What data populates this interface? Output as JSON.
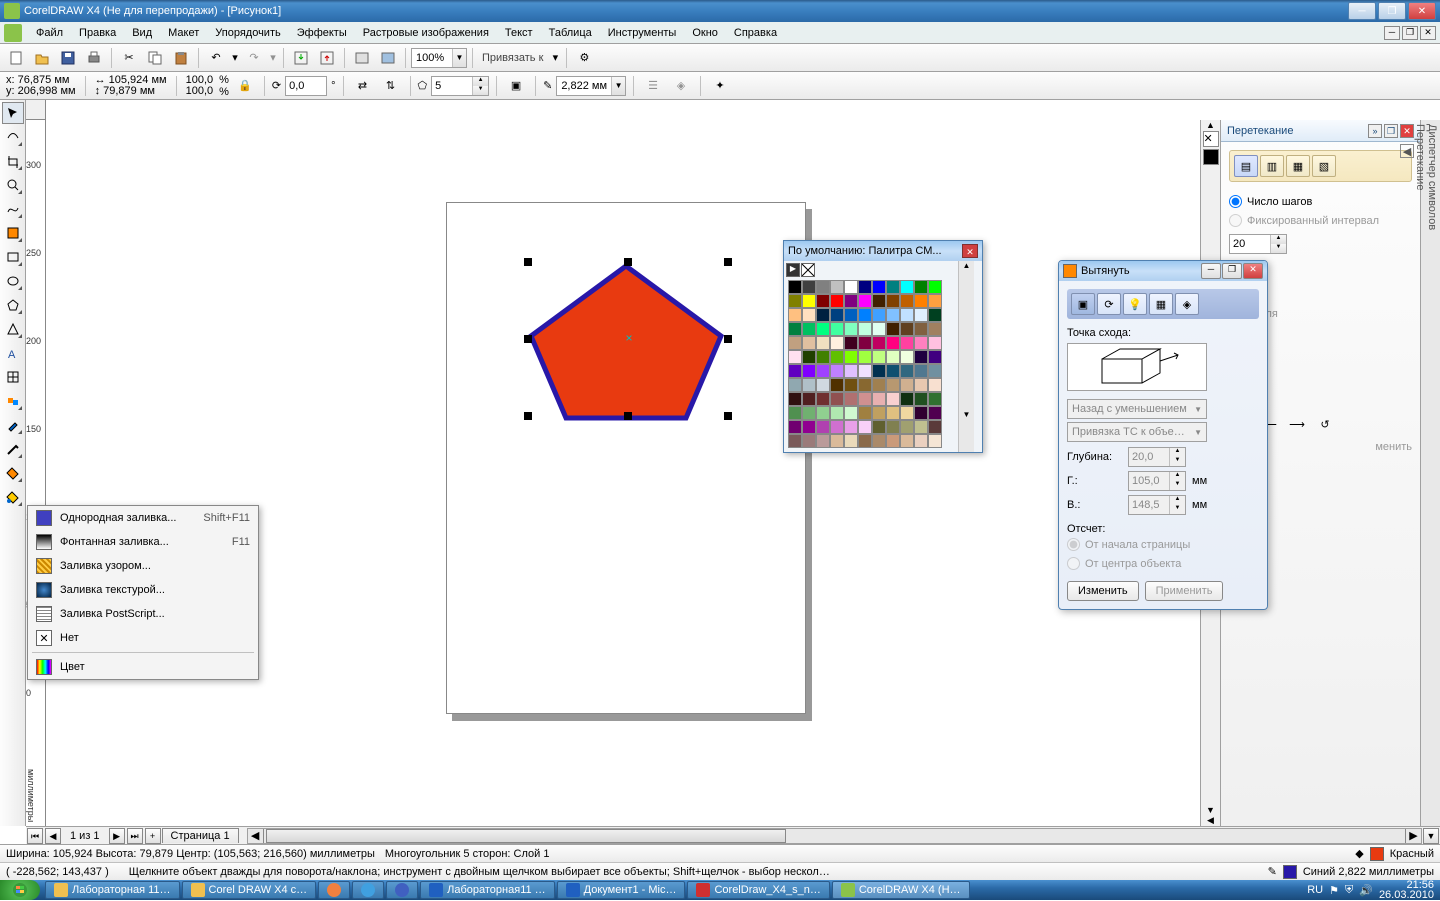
{
  "titlebar": {
    "text": "CorelDRAW X4 (Не для перепродажи) - [Рисунок1]"
  },
  "menu": [
    "Файл",
    "Правка",
    "Вид",
    "Макет",
    "Упорядочить",
    "Эффекты",
    "Растровые изображения",
    "Текст",
    "Таблица",
    "Инструменты",
    "Окно",
    "Справка"
  ],
  "toolbar": {
    "zoom": "100%",
    "snap_label": "Привязать к"
  },
  "propbar": {
    "x_label": "x:",
    "x_val": "76,875 мм",
    "y_label": "y:",
    "y_val": "206,998 мм",
    "w_val": "105,924 мм",
    "h_val": "79,879 мм",
    "sx": "100,0",
    "sy": "100,0",
    "pct": "%",
    "rot": "0,0",
    "deg": "°",
    "sides": "5",
    "outline": "2,822 мм"
  },
  "ruler_units": "миллиметры",
  "ruler_v_label": "миллиметры",
  "flyout": {
    "items": [
      {
        "label": "Однородная заливка...",
        "shortcut": "Shift+F11"
      },
      {
        "label": "Фонтанная заливка...",
        "shortcut": "F11"
      },
      {
        "label": "Заливка узором...",
        "shortcut": ""
      },
      {
        "label": "Заливка текстурой...",
        "shortcut": ""
      },
      {
        "label": "Заливка PostScript...",
        "shortcut": ""
      },
      {
        "label": "Нет",
        "shortcut": ""
      },
      {
        "label": "Цвет",
        "shortcut": ""
      }
    ]
  },
  "palette_win": {
    "title": "По умолчанию: Палитра СМ..."
  },
  "extrude": {
    "title": "Вытянуть",
    "vanish_label": "Точка схода:",
    "combo1": "Назад с уменьшением",
    "combo2": "Привязка ТС к объе…",
    "depth_label": "Глубина:",
    "depth": "20,0",
    "g_label": "Г.:",
    "g_val": "105,0",
    "v_label": "В.:",
    "v_val": "148,5",
    "mm": "мм",
    "origin_label": "Отсчет:",
    "origin_opt1": "От начала страницы",
    "origin_opt2": "От центра объекта",
    "btn_edit": "Изменить",
    "btn_apply": "Применить"
  },
  "docker": {
    "title": "Перетекание",
    "steps_label": "Число шагов",
    "fixed_label": "Фиксированный интервал",
    "steps": "20",
    "loop_label": "Петля",
    "tab1": "Диспетчер символов",
    "tab2": "Перетекание",
    "apply_hint": "менить"
  },
  "pagenav": {
    "of": "1 из 1",
    "tab": "Страница 1"
  },
  "status1": {
    "dims": "Ширина: 105,924  Высота: 79,879  Центр: (105,563; 216,560)  миллиметры",
    "obj": "Многоугольник  5 сторон:  Слой 1",
    "fill_name": "Красный"
  },
  "status2": {
    "coords": "( -228,562; 143,437 )",
    "hint": "Щелкните объект дважды для поворота/наклона; инструмент с двойным щелчком выбирает все объекты; Shift+щелчок - выбор нескол…",
    "outline_name": "Синий  2,822 миллиметры"
  },
  "taskbar": {
    "items": [
      "Лабораторная 11…",
      "Corel DRAW X4 с…",
      "",
      "",
      "",
      "Лабораторная11 …",
      "Документ1 - Mic…",
      "CorelDraw_X4_s_n…",
      "CorelDRAW X4 (Н…"
    ],
    "lang": "RU",
    "time": "21:56",
    "date": "26.03.2010"
  },
  "palette_colors": [
    "#000000",
    "#404040",
    "#808080",
    "#c0c0c0",
    "#ffffff",
    "#000080",
    "#0000ff",
    "#008080",
    "#00ffff",
    "#008000",
    "#00ff00",
    "#808000",
    "#ffff00",
    "#800000",
    "#ff0000",
    "#800080",
    "#ff00ff",
    "#402000",
    "#804000",
    "#c06000",
    "#ff8000",
    "#ffa040",
    "#ffc080",
    "#ffe0c0",
    "#002040",
    "#004080",
    "#0060c0",
    "#0080ff",
    "#40a0ff",
    "#80c0ff",
    "#c0e0ff",
    "#e0f0ff",
    "#004020",
    "#008040",
    "#00c060",
    "#00ff80",
    "#40ffa0",
    "#80ffc0",
    "#c0ffe0",
    "#e0fff0",
    "#402000",
    "#604020",
    "#806040",
    "#a08060",
    "#c0a080",
    "#e0c0a0",
    "#f0e0c0",
    "#fff0e0",
    "#400020",
    "#800040",
    "#c00060",
    "#ff0080",
    "#ff40a0",
    "#ff80c0",
    "#ffc0e0",
    "#ffe0f0",
    "#204000",
    "#408000",
    "#60c000",
    "#80ff00",
    "#a0ff40",
    "#c0ff80",
    "#e0ffc0",
    "#f0ffe0",
    "#200040",
    "#400080",
    "#6000c0",
    "#8000ff",
    "#a040ff",
    "#c080ff",
    "#e0c0ff",
    "#f0e0ff",
    "#003050",
    "#105070",
    "#306880",
    "#507890",
    "#7090a0",
    "#90a8b0",
    "#b0c0c8",
    "#d0d8e0",
    "#503000",
    "#705010",
    "#886830",
    "#a08050",
    "#b89870",
    "#d0b090",
    "#e8c8b0",
    "#f8e0d0",
    "#301010",
    "#502020",
    "#703030",
    "#905050",
    "#b07070",
    "#d09090",
    "#e8b0b0",
    "#f8d0d0",
    "#103010",
    "#205020",
    "#307030",
    "#509050",
    "#70b070",
    "#90d090",
    "#b0e8b0",
    "#d0f8d0",
    "#a08040",
    "#c0a060",
    "#e0c080",
    "#f0d8a0",
    "#300030",
    "#500050",
    "#700070",
    "#900090",
    "#b040b0",
    "#d070d0",
    "#e8a0e8",
    "#f8d0f8",
    "#606030",
    "#808050",
    "#a0a070",
    "#c0c090",
    "#5a3a3a",
    "#7a5a5a",
    "#9a7a7a",
    "#ba9a9a",
    "#daba9a",
    "#eadaba",
    "#8a6a4a",
    "#aa8a6a",
    "#ca9a7a",
    "#daba9a",
    "#ead0c0",
    "#f5e5d5"
  ]
}
